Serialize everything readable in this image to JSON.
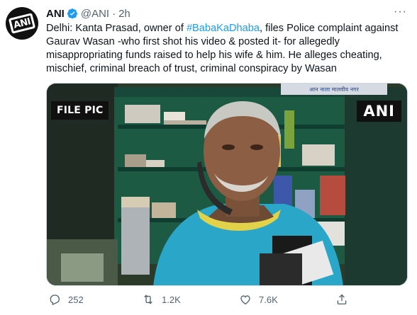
{
  "tweet": {
    "author_name": "ANI",
    "handle": "@ANI",
    "separator": "·",
    "time": "2h",
    "more_label": "···",
    "text_parts": {
      "before": "Delhi: Kanta Prasad, owner of ",
      "hashtag": "#BabaKaDhaba",
      "after": ", files Police complaint against Gaurav Wasan -who first shot his video & posted it- for allegedly misappropriating funds raised to help his wife & him. He alleges cheating, mischief, criminal breach of trust, criminal conspiracy by Wasan"
    },
    "avatar_logo_text": "ANI",
    "media": {
      "badge_left": "FILE PIC",
      "badge_right": "ANI",
      "sign_text": "आन नाला मालवीय नगर"
    },
    "counts": {
      "replies": "252",
      "retweets": "1.2K",
      "likes": "7.6K"
    }
  },
  "colors": {
    "accent": "#1d9bf0",
    "muted": "#536471",
    "text": "#0f1419"
  },
  "icons": [
    "verified-badge-icon",
    "more-icon",
    "reply-icon",
    "retweet-icon",
    "like-icon",
    "share-icon"
  ]
}
